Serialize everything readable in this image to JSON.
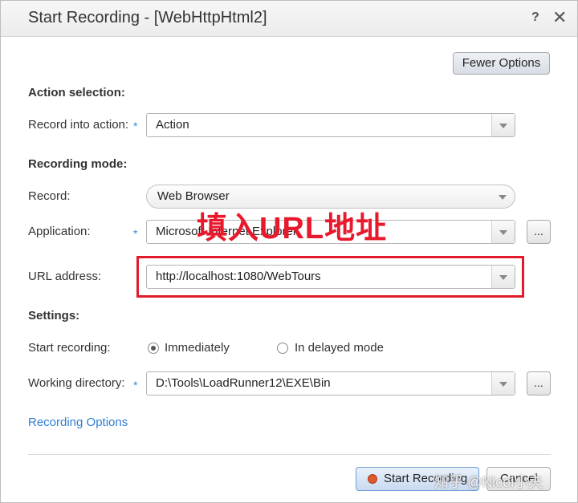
{
  "window": {
    "title": "Start Recording - [WebHttpHtml2]",
    "help": "?",
    "close": "✕"
  },
  "buttons": {
    "fewer_options": "Fewer Options",
    "start_recording": "Start Recording",
    "cancel": "Cancel",
    "ellipsis": "..."
  },
  "action_selection": {
    "heading": "Action selection:",
    "record_into_label": "Record into action:",
    "record_into_value": "Action"
  },
  "recording_mode": {
    "heading": "Recording mode:",
    "record_label": "Record:",
    "record_value": "Web Browser",
    "application_label": "Application:",
    "application_value": "Microsoft Internet Explorer",
    "url_label": "URL address:",
    "url_value": "http://localhost:1080/WebTours"
  },
  "settings": {
    "heading": "Settings:",
    "start_label": "Start recording:",
    "option_immediately": "Immediately",
    "option_delayed": "In delayed mode",
    "selected": "Immediately",
    "workdir_label": "Working directory:",
    "workdir_value": "D:\\Tools\\LoadRunner12\\EXE\\Bin"
  },
  "required_marker": "*",
  "recording_options_link": "Recording Options",
  "annotation": "填入URL地址",
  "watermark": "知乎 @Nicol小夫",
  "colors": {
    "annotation_red": "#e8192c",
    "link_blue": "#2f7fd3",
    "required_blue": "#3b86d6"
  }
}
